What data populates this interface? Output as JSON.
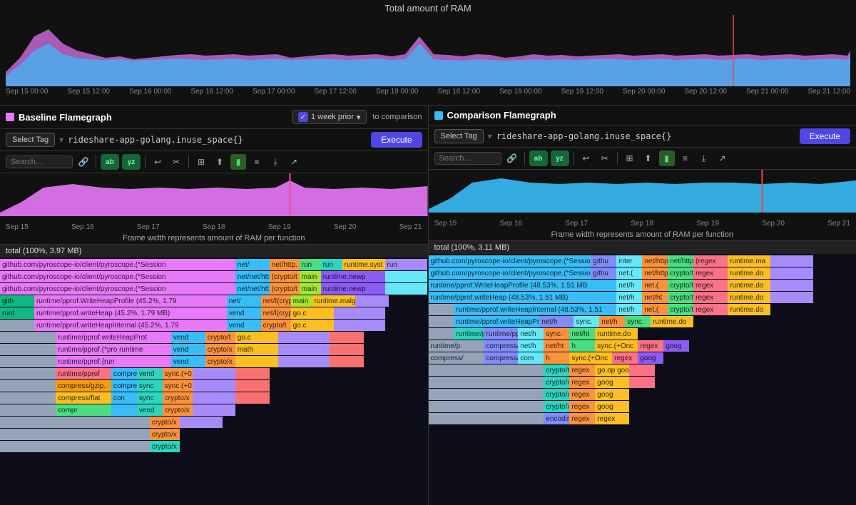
{
  "app": {
    "title": "Total amount of RAM"
  },
  "timeline": {
    "labels": [
      "Sep 15 00:00",
      "Sep 15 12:00",
      "Sep 16 00:00",
      "Sep 16 12:00",
      "Sep 17 00:00",
      "Sep 17 12:00",
      "Sep 18 00:00",
      "Sep 18 12:00",
      "Sep 19 00:00",
      "Sep 19 12:00",
      "Sep 20 00:00",
      "Sep 20 12:00",
      "Sep 21 00:00",
      "Sep 21 12:00"
    ]
  },
  "baseline": {
    "title": "Baseline Flamegraph",
    "dot_color": "pink",
    "week_prior": "1 week prior",
    "to_comparison": "to comparison",
    "select_tag": "Select Tag",
    "query": "rideshare-app-golang.inuse_space{}",
    "execute": "Execute",
    "search_placeholder": "Search...",
    "frame_info": "Frame width represents amount of RAM per function",
    "total_label": "total (100%, 3.97 MB)",
    "timeline_labels": [
      "Sep 15",
      "Sep 16",
      "Sep 17",
      "Sep 18",
      "Sep 19",
      "Sep 20",
      "Sep 21"
    ]
  },
  "comparison": {
    "title": "Comparison Flamegraph",
    "dot_color": "blue",
    "select_tag": "Select Tag",
    "query": "rideshare-app-golang.inuse_space{}",
    "execute": "Execute",
    "search_placeholder": "Search...",
    "frame_info": "Frame width represents amount of RAM per function",
    "total_label": "total (100%, 3.11 MB)",
    "timeline_labels": [
      "Sep 15",
      "Sep 16",
      "Sep 17",
      "Sep 18",
      "Sep 19",
      "Sep 20",
      "Sep 21"
    ]
  }
}
